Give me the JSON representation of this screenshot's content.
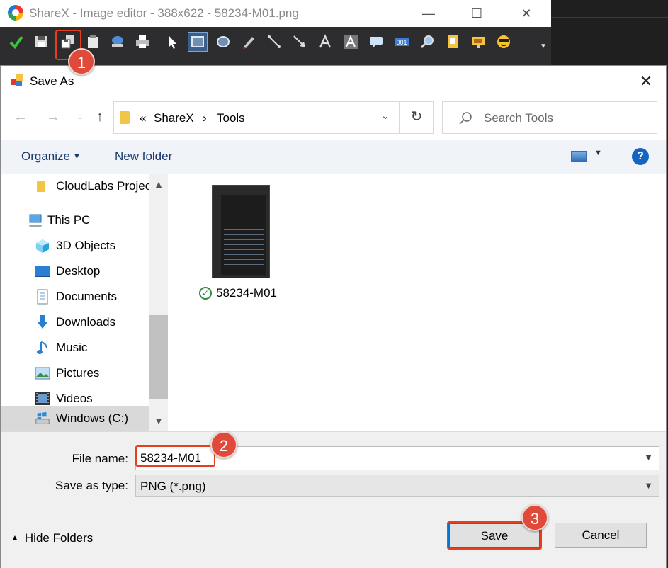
{
  "editor": {
    "title": "ShareX - Image editor - 388x622 - 58234-M01.png",
    "toolbar_icons": [
      "check-icon",
      "save-icon",
      "save-as-icon",
      "clipboard-icon",
      "upload-icon",
      "print-icon",
      "cursor-icon",
      "rectangle-icon",
      "ellipse-icon",
      "pen-icon",
      "line-icon",
      "arrow-icon",
      "text-icon",
      "text-background-icon",
      "speech-balloon-icon",
      "step-icon",
      "magnify-icon",
      "sticker-icon",
      "image-icon",
      "emoji-icon"
    ],
    "window_controls": [
      "minimize",
      "maximize",
      "close"
    ]
  },
  "annotations": {
    "step1": "1",
    "step2": "2",
    "step3": "3",
    "highlight_color": "#e5401e",
    "badge_color": "#e04a3a"
  },
  "dialog": {
    "title": "Save As",
    "close_glyph": "✕",
    "address": {
      "prefix": "«",
      "crumbs": [
        "ShareX",
        "Tools"
      ],
      "separator": "›"
    },
    "search": {
      "placeholder": "Search Tools"
    },
    "commands": {
      "organize": "Organize",
      "new_folder": "New folder",
      "help": "?"
    },
    "nav_items": [
      {
        "label": "CloudLabs Projec",
        "icon": "folder-icon"
      },
      {
        "label": "This PC",
        "icon": "computer-icon"
      },
      {
        "label": "3D Objects",
        "icon": "3d-objects-icon"
      },
      {
        "label": "Desktop",
        "icon": "desktop-icon"
      },
      {
        "label": "Documents",
        "icon": "documents-icon"
      },
      {
        "label": "Downloads",
        "icon": "downloads-icon"
      },
      {
        "label": "Music",
        "icon": "music-icon"
      },
      {
        "label": "Pictures",
        "icon": "pictures-icon"
      },
      {
        "label": "Videos",
        "icon": "videos-icon"
      },
      {
        "label": "Windows (C:)",
        "icon": "drive-icon"
      }
    ],
    "files": [
      {
        "name": "58234-M01",
        "status": "synced"
      }
    ],
    "file_name_label": "File name:",
    "file_name_value": "58234-M01",
    "save_type_label": "Save as type:",
    "save_type_value": "PNG (*.png)",
    "hide_folders": "Hide Folders",
    "save_button": "Save",
    "cancel_button": "Cancel"
  }
}
